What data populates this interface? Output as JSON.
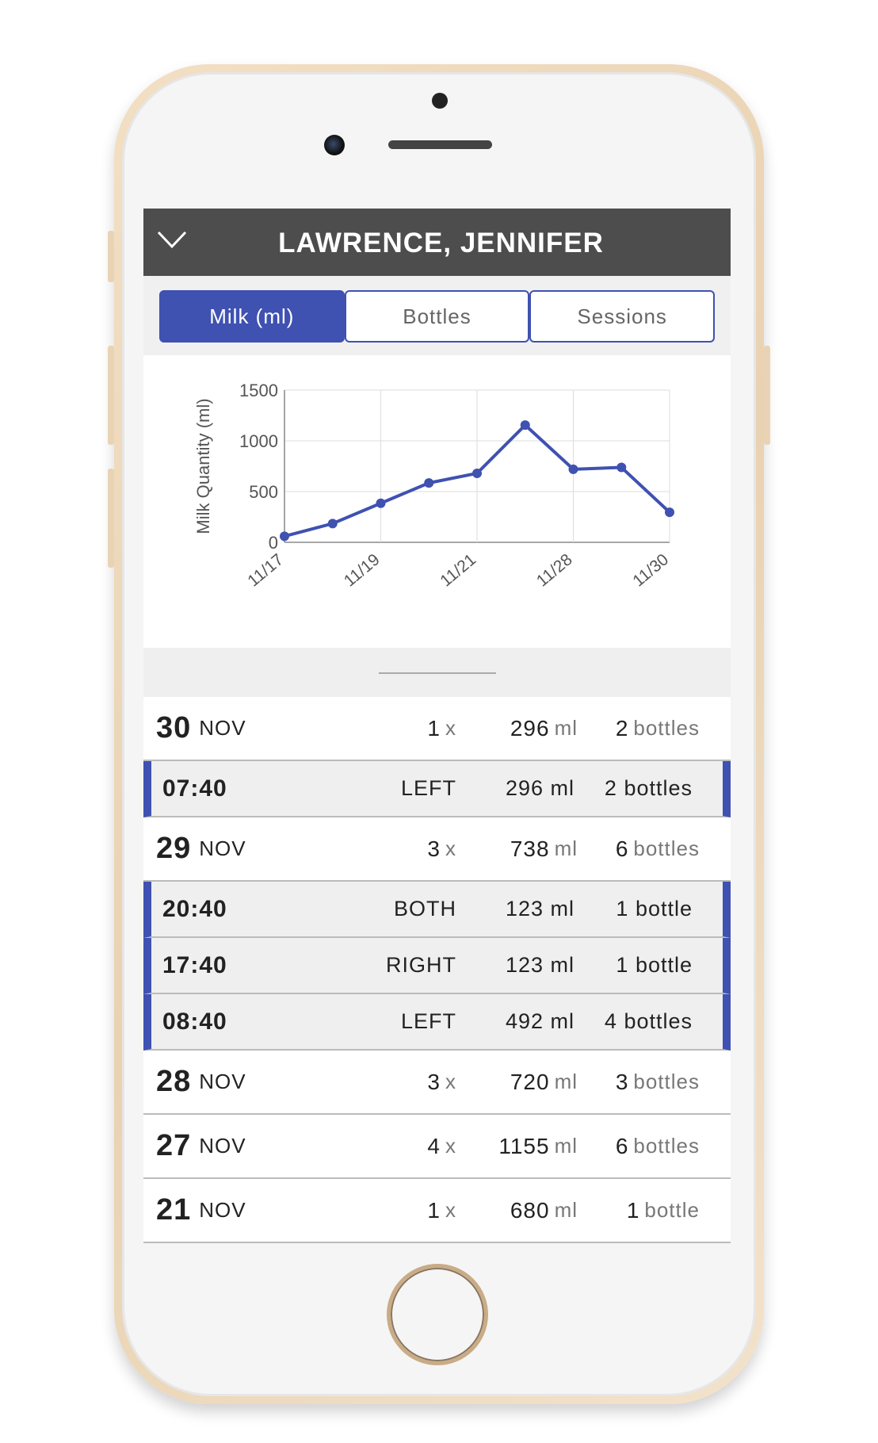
{
  "header": {
    "title": "LAWRENCE, JENNIFER"
  },
  "tabs": [
    {
      "label": "Milk (ml)",
      "active": true
    },
    {
      "label": "Bottles",
      "active": false
    },
    {
      "label": "Sessions",
      "active": false
    }
  ],
  "colors": {
    "accent": "#3f51b1",
    "header_bg": "#4d4d4d"
  },
  "chart_data": {
    "type": "line",
    "ylabel": "Milk Quantity (ml)",
    "xlabel": "",
    "x": [
      "11/17",
      "11/18",
      "11/19",
      "11/20",
      "11/21",
      "11/27",
      "11/28",
      "11/29",
      "11/30"
    ],
    "x_tick_labels": [
      "11/17",
      "11/19",
      "11/21",
      "11/28",
      "11/30"
    ],
    "values": [
      60,
      185,
      385,
      585,
      680,
      1155,
      720,
      738,
      296
    ],
    "ylim": [
      0,
      1500
    ],
    "y_ticks": [
      "0",
      "500",
      "1000",
      "1500"
    ],
    "grid": true
  },
  "days": [
    {
      "day": "30",
      "month": "NOV",
      "count": "1",
      "count_unit": "x",
      "ml": "296",
      "ml_unit": "ml",
      "bottles": "2",
      "bottles_unit": "bottles",
      "sessions": [
        {
          "time": "07:40",
          "side": "LEFT",
          "ml": "296 ml",
          "bottles": "2 bottles"
        }
      ]
    },
    {
      "day": "29",
      "month": "NOV",
      "count": "3",
      "count_unit": "x",
      "ml": "738",
      "ml_unit": "ml",
      "bottles": "6",
      "bottles_unit": "bottles",
      "sessions": [
        {
          "time": "20:40",
          "side": "BOTH",
          "ml": "123 ml",
          "bottles": "1 bottle"
        },
        {
          "time": "17:40",
          "side": "RIGHT",
          "ml": "123 ml",
          "bottles": "1 bottle"
        },
        {
          "time": "08:40",
          "side": "LEFT",
          "ml": "492 ml",
          "bottles": "4 bottles"
        }
      ]
    },
    {
      "day": "28",
      "month": "NOV",
      "count": "3",
      "count_unit": "x",
      "ml": "720",
      "ml_unit": "ml",
      "bottles": "3",
      "bottles_unit": "bottles",
      "sessions": []
    },
    {
      "day": "27",
      "month": "NOV",
      "count": "4",
      "count_unit": "x",
      "ml": "1155",
      "ml_unit": "ml",
      "bottles": "6",
      "bottles_unit": "bottles",
      "sessions": []
    },
    {
      "day": "21",
      "month": "NOV",
      "count": "1",
      "count_unit": "x",
      "ml": "680",
      "ml_unit": "ml",
      "bottles": "1",
      "bottles_unit": "bottle",
      "sessions": []
    }
  ]
}
